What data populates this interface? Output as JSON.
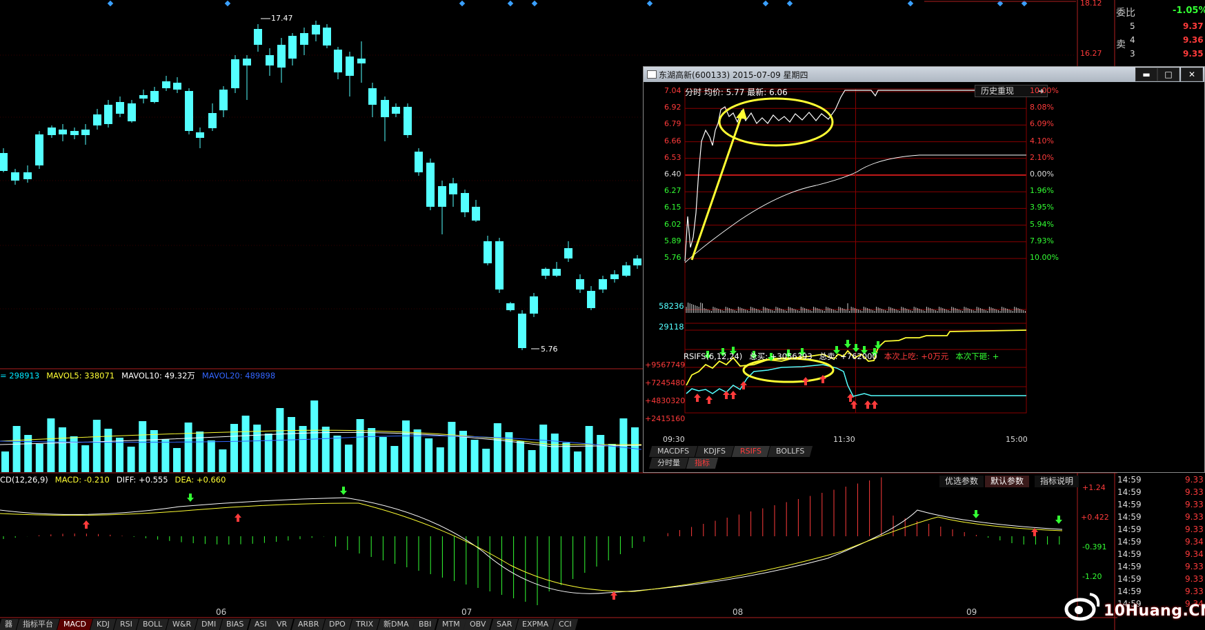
{
  "kline": {
    "high_label": "17.47",
    "low_label": "5.76",
    "right_axis": [
      "18.12",
      "16.27"
    ],
    "date_labels": [
      "06",
      "07",
      "08",
      "09"
    ]
  },
  "volume": {
    "legend": [
      {
        "text": "= 298913",
        "color": "#00e6ff"
      },
      {
        "text": "MAVOL5: 338071",
        "color": "#ffff33"
      },
      {
        "text": "MAVOL10: 49.32万",
        "color": "#ffffff"
      },
      {
        "text": "MAVOL20: 489898",
        "color": "#3366ff"
      }
    ]
  },
  "macd": {
    "legend": [
      {
        "text": "CD(12,26,9)",
        "color": "#ffffff"
      },
      {
        "text": "MACD: -0.210",
        "color": "#ffff33"
      },
      {
        "text": "DIFF: +0.555",
        "color": "#ffffff"
      },
      {
        "text": "DEA: +0.660",
        "color": "#ffff33"
      }
    ],
    "axis": [
      "+1.24",
      "+0.422",
      "-0.391",
      "-1.20"
    ],
    "buttons": [
      "优选参数",
      "默认参数",
      "指标说明"
    ]
  },
  "right_panel": {
    "weibi_label": "委比",
    "weibi_value": "-1.05%",
    "sell_label": "卖",
    "asks": [
      {
        "level": "5",
        "price": "9.37"
      },
      {
        "level": "4",
        "price": "9.36"
      },
      {
        "level": "3",
        "price": "9.35"
      }
    ],
    "ticks": [
      {
        "time": "14:59",
        "price": "9.33"
      },
      {
        "time": "14:59",
        "price": "9.33"
      },
      {
        "time": "14:59",
        "price": "9.33"
      },
      {
        "time": "14:59",
        "price": "9.33"
      },
      {
        "time": "14:59",
        "price": "9.33"
      },
      {
        "time": "14:59",
        "price": "9.34"
      },
      {
        "time": "14:59",
        "price": "9.34"
      },
      {
        "time": "14:59",
        "price": "9.33"
      },
      {
        "time": "14:59",
        "price": "9.33"
      },
      {
        "time": "14:59",
        "price": "9.33"
      },
      {
        "time": "14:59",
        "price": "9.34"
      }
    ]
  },
  "popup": {
    "title": "东湖高新(600133) 2015-07-09 星期四",
    "header": "分时  均价: 5.77  最新: 6.06",
    "history_button": "历史重现",
    "price_axis": [
      "7.04",
      "6.92",
      "6.79",
      "6.66",
      "6.53",
      "6.40",
      "6.27",
      "6.15",
      "6.02",
      "5.89",
      "5.76"
    ],
    "pct_axis": [
      "10.00%",
      "8.08%",
      "6.09%",
      "4.10%",
      "2.10%",
      "0.00%",
      "1.96%",
      "3.95%",
      "5.94%",
      "7.93%",
      "10.00%"
    ],
    "volume_axis": [
      "58236",
      "29118"
    ],
    "rsifs_legend": [
      {
        "text": "RSIFS(6,12,24)",
        "color": "#ffffff"
      },
      {
        "text": "总买: +3056393",
        "color": "#ffffff"
      },
      {
        "text": "总卖: +762000",
        "color": "#ffffff"
      },
      {
        "text": "本次上吃: +0万元",
        "color": "#ff3b3b"
      },
      {
        "text": "本次下砸: +",
        "color": "#33ff33"
      }
    ],
    "rsifs_axis": [
      "+9567749",
      "+7245480",
      "+4830320",
      "+2415160"
    ],
    "time_axis": [
      "09:30",
      "11:30",
      "15:00"
    ],
    "tabs": [
      "MACDFS",
      "KDJFS",
      "RSIFS",
      "BOLLFS"
    ],
    "active_tab": "RSIFS",
    "tabs2": [
      "分时量",
      "指标"
    ],
    "active_tab2": "指标"
  },
  "bottom_tabs": [
    "器",
    "指标平台",
    "MACD",
    "KDJ",
    "RSI",
    "BOLL",
    "W&R",
    "DMI",
    "BIAS",
    "ASI",
    "VR",
    "ARBR",
    "DPO",
    "TRIX",
    "新DMA",
    "BBI",
    "MTM",
    "OBV",
    "SAR",
    "EXPMA",
    "CCI"
  ],
  "active_bottom_tab": "MACD",
  "watermark": "10Huang.CN",
  "colors": {
    "up": "#ff3b3b",
    "down": "#54ffff",
    "axis": "#b02020",
    "yellow": "#ffff33"
  }
}
